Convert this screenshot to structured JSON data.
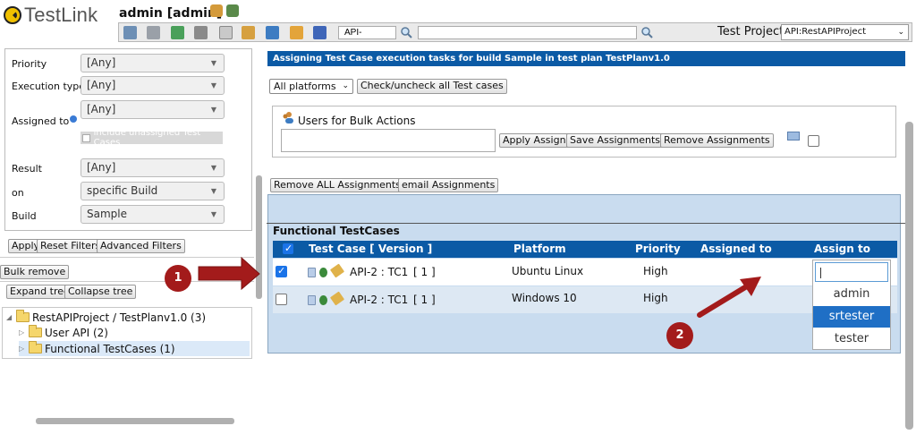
{
  "header": {
    "logo_text": "TestLink",
    "user": "admin [admin]",
    "search_tc_value": "API-",
    "search_global_value": "",
    "test_project_label": "Test Project",
    "test_project_value": "API:RestAPIProject",
    "icons": [
      "user-prefs-icon",
      "logout-icon",
      "desktop-icon",
      "cart-icon",
      "sitemap-icon",
      "tools-icon",
      "document-icon",
      "list-icon",
      "users-icon",
      "events-icon",
      "bug-icon",
      "search-icon"
    ]
  },
  "filters": {
    "priority": {
      "label": "Priority",
      "value": "[Any]"
    },
    "execution_type": {
      "label": "Execution type",
      "value": "[Any]"
    },
    "assigned_to": {
      "label": "Assigned to",
      "value": "[Any]",
      "include_unassigned": "include unassigned Test Cases"
    },
    "result": {
      "label": "Result",
      "value": "[Any]"
    },
    "on": {
      "label": "on",
      "value": "specific Build"
    },
    "build": {
      "label": "Build",
      "value": "Sample"
    },
    "buttons": {
      "apply": "Apply",
      "reset": "Reset Filters",
      "advanced": "Advanced Filters"
    }
  },
  "left": {
    "bulk_remove": "Bulk remove",
    "expand_tree": "Expand tree",
    "collapse_tree": "Collapse tree",
    "tree": [
      {
        "label": "RestAPIProject / TestPlanv1.0 (3)"
      },
      {
        "label": "User API (2)"
      },
      {
        "label": "Functional TestCases (1)"
      }
    ]
  },
  "main": {
    "title": "Assigning Test Case execution tasks for build Sample in test plan TestPlanv1.0",
    "platforms_select": "All platforms",
    "check_all_button": "Check/uncheck all Test cases",
    "bulk": {
      "title": "Users for Bulk Actions",
      "input_value": "",
      "apply_assign": "Apply Assign",
      "save_assignments": "Save Assignments",
      "remove_assignments": "Remove Assignments"
    },
    "remove_all": "Remove ALL Assignments",
    "email_assignments": "email Assignments",
    "section_title": "Functional TestCases",
    "columns": [
      "Test Case [ Version ]",
      "Platform",
      "Priority",
      "Assigned to",
      "Assign to"
    ],
    "rows": [
      {
        "checked": true,
        "test_case": "API-2 : TC1",
        "version": "[ 1 ]",
        "platform": "Ubuntu Linux",
        "priority": "High",
        "assigned_to": ""
      },
      {
        "checked": false,
        "test_case": "API-2 : TC1",
        "version": "[ 1 ]",
        "platform": "Windows 10",
        "priority": "High",
        "assigned_to": ""
      }
    ],
    "assign_dropdown": {
      "input_value": "",
      "options": [
        "admin",
        "srtester",
        "tester"
      ],
      "highlighted": "srtester"
    }
  },
  "annotations": {
    "marker_1": "1",
    "marker_2": "2"
  },
  "colors": {
    "accent": "#0b5aa5",
    "panel_bg": "#c9dcef",
    "annotation": "#a31b1b"
  }
}
